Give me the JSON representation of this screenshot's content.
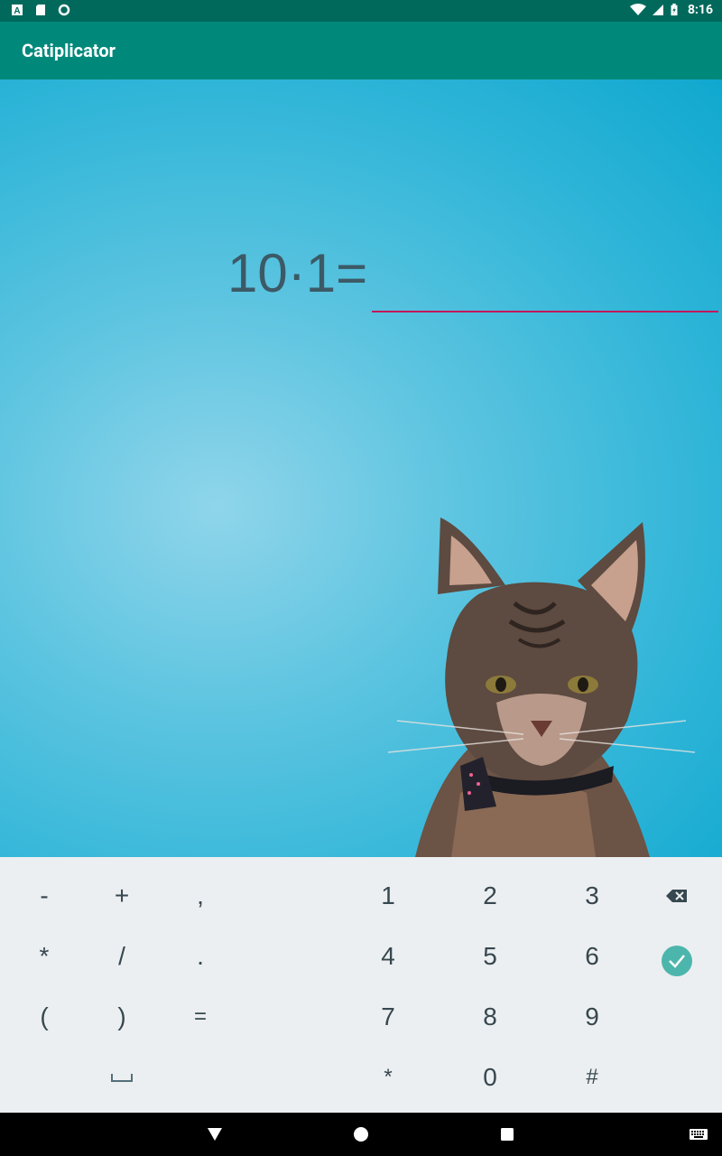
{
  "status_bar": {
    "time": "8:16"
  },
  "app": {
    "title": "Catiplicator"
  },
  "quiz": {
    "equation": "10·1=",
    "answer_value": "",
    "answer_placeholder": ""
  },
  "keyboard": {
    "rows": [
      [
        "-",
        "+",
        ",",
        "1",
        "2",
        "3"
      ],
      [
        "*",
        "/",
        ".",
        "4",
        "5",
        "6"
      ],
      [
        "(",
        ")",
        "=",
        "7",
        "8",
        "9"
      ],
      [
        "*",
        "0",
        "#"
      ]
    ]
  },
  "colors": {
    "status_bar": "#00695c",
    "app_bar": "#00897b",
    "input_underline": "#c2185b",
    "keyboard_bg": "#eceff1",
    "check_button": "#4db6ac"
  }
}
